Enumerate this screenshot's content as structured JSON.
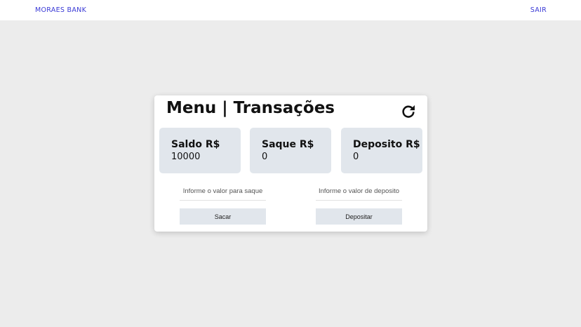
{
  "header": {
    "brand": "MORAES BANK",
    "logout_label": "SAIR"
  },
  "card": {
    "title": "Menu | Transações",
    "refresh_icon": "refresh-icon"
  },
  "tiles": {
    "saldo": {
      "label": "Saldo R$",
      "value": "10000"
    },
    "saque": {
      "label": "Saque R$",
      "value": "0"
    },
    "deposito": {
      "label": "Deposito R$",
      "value": "0"
    }
  },
  "form": {
    "saque_placeholder": "Informe o valor para saque",
    "deposito_placeholder": "Informe o valor de deposito",
    "sacar_label": "Sacar",
    "depositar_label": "Depositar"
  },
  "colors": {
    "background": "#ececec",
    "link": "#3a3ad6",
    "tile": "#e1e6ec"
  }
}
